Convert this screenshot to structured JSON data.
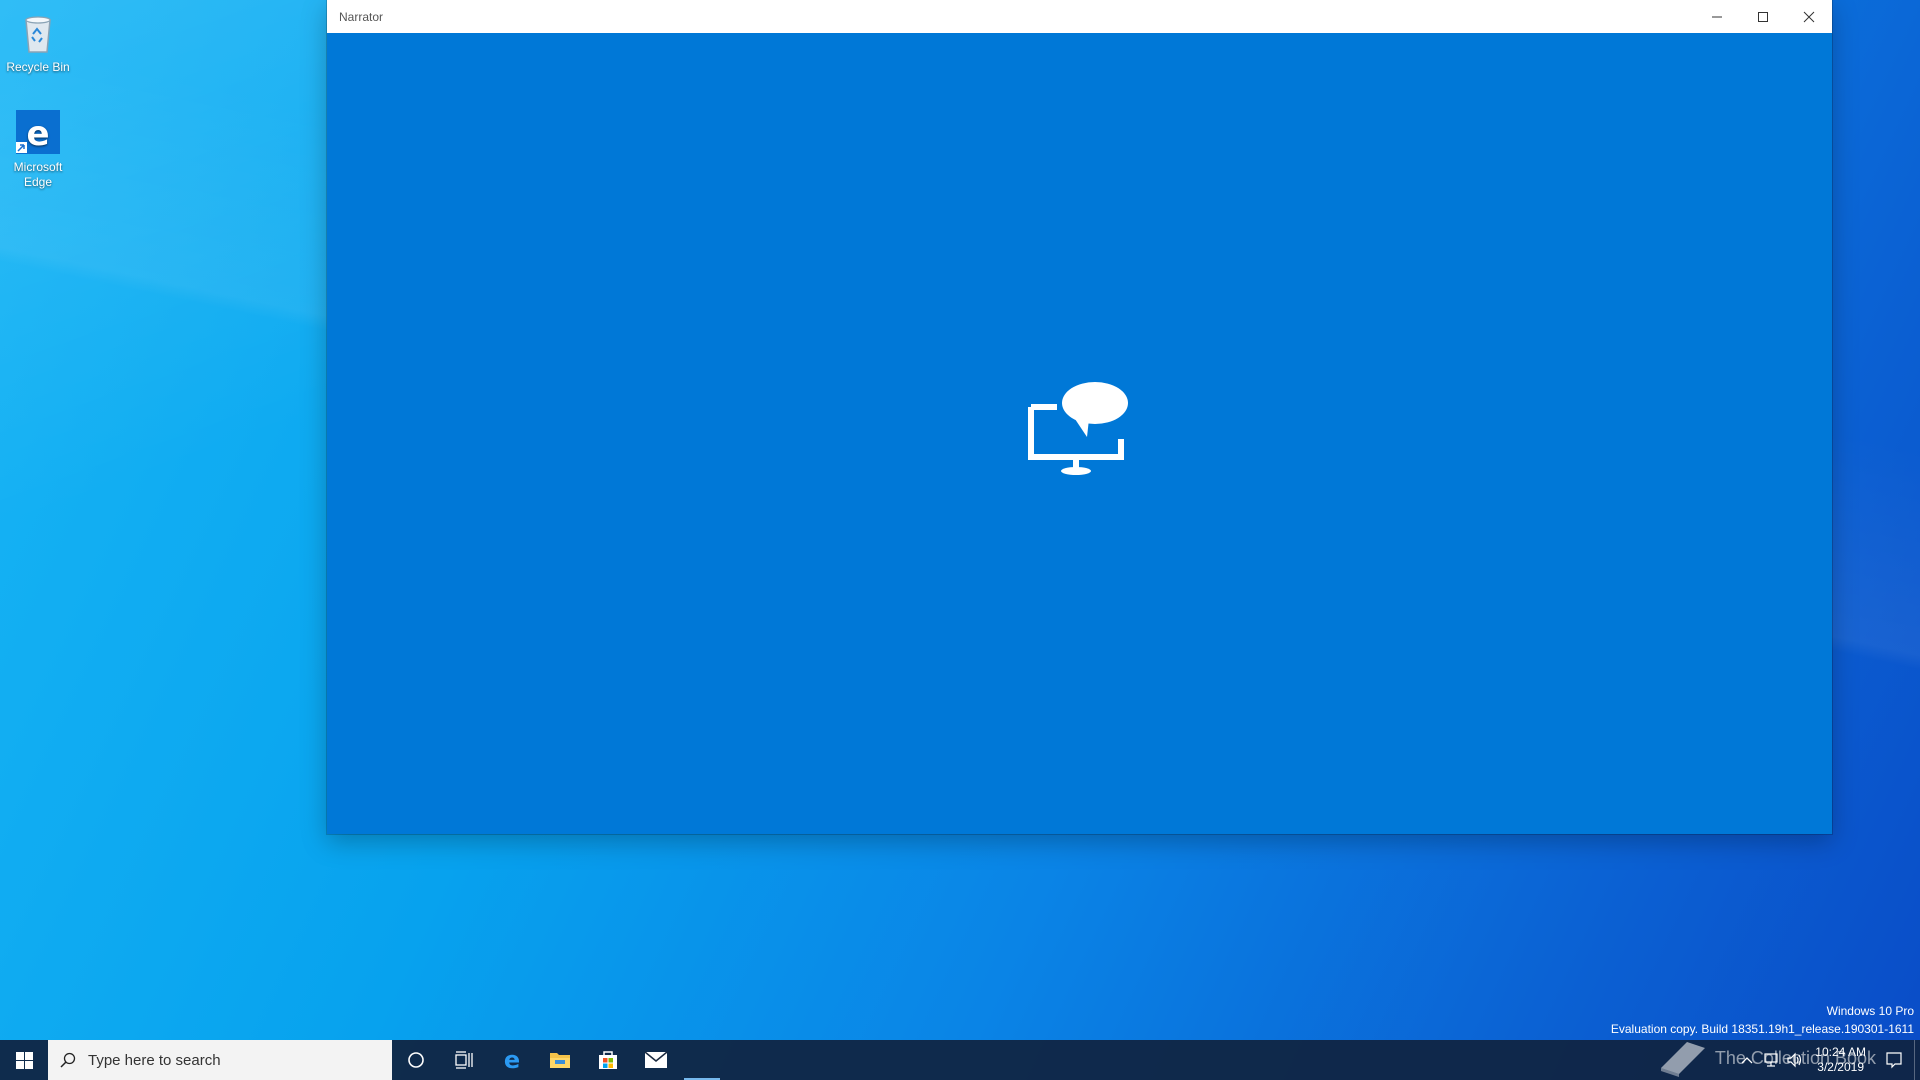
{
  "desktop": {
    "icons": [
      {
        "label": "Recycle Bin",
        "icon": "recycle-bin-icon"
      },
      {
        "label": "Microsoft Edge",
        "icon": "edge-icon"
      }
    ]
  },
  "window": {
    "title": "Narrator",
    "buttons": {
      "minimize": "minimize-icon",
      "maximize": "maximize-icon",
      "close": "close-icon"
    },
    "logo": "narrator-icon",
    "accent_color": "#0078d7"
  },
  "watermark": {
    "line1": "Windows 10 Pro",
    "line2": "Evaluation copy. Build 18351.19h1_release.190301-1611"
  },
  "taskbar": {
    "search_placeholder": "Type here to search",
    "pinned": [
      {
        "name": "cortana",
        "icon": "circle-icon"
      },
      {
        "name": "task-view",
        "icon": "task-view-icon"
      },
      {
        "name": "edge",
        "icon": "edge-icon"
      },
      {
        "name": "file-explorer",
        "icon": "folder-icon"
      },
      {
        "name": "store",
        "icon": "store-icon"
      },
      {
        "name": "mail",
        "icon": "mail-icon"
      }
    ],
    "clock": {
      "time": "10:24 AM",
      "date": "3/2/2019"
    },
    "overlay_text": "The Collection Book"
  }
}
